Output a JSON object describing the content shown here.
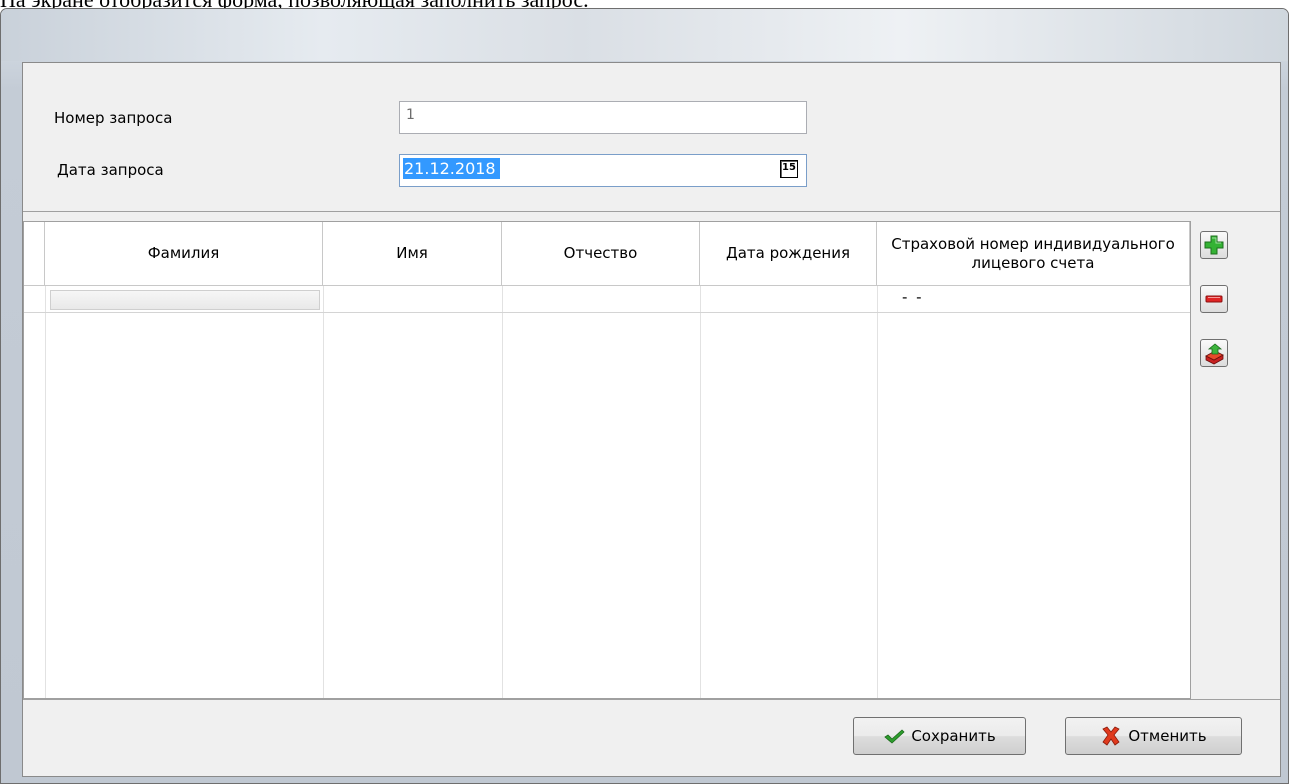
{
  "document": {
    "caption": "На экране отобразится форма, позволяющая заполнить запрос."
  },
  "form": {
    "request_number_label": "Номер запроса",
    "request_number_value": "1",
    "request_date_label": "Дата запроса",
    "request_date_value": "21.12.2018",
    "calendar_icon_text": "15"
  },
  "table": {
    "columns": [
      "Фамилия",
      "Имя",
      "Отчество",
      "Дата рождения",
      "Страховой номер индивидуального лицевого счета"
    ],
    "snils_mask": "- -"
  },
  "toolbar": {
    "add_icon": "plus-icon",
    "remove_icon": "minus-icon",
    "import_icon": "import-icon"
  },
  "buttons": {
    "save_label": "Сохранить",
    "cancel_label": "Отменить"
  },
  "colors": {
    "selection": "#3399ff",
    "add_green": "#2fa62f",
    "remove_red": "#d82020",
    "cancel_red": "#e03a1e",
    "save_green": "#2e9d2e"
  }
}
